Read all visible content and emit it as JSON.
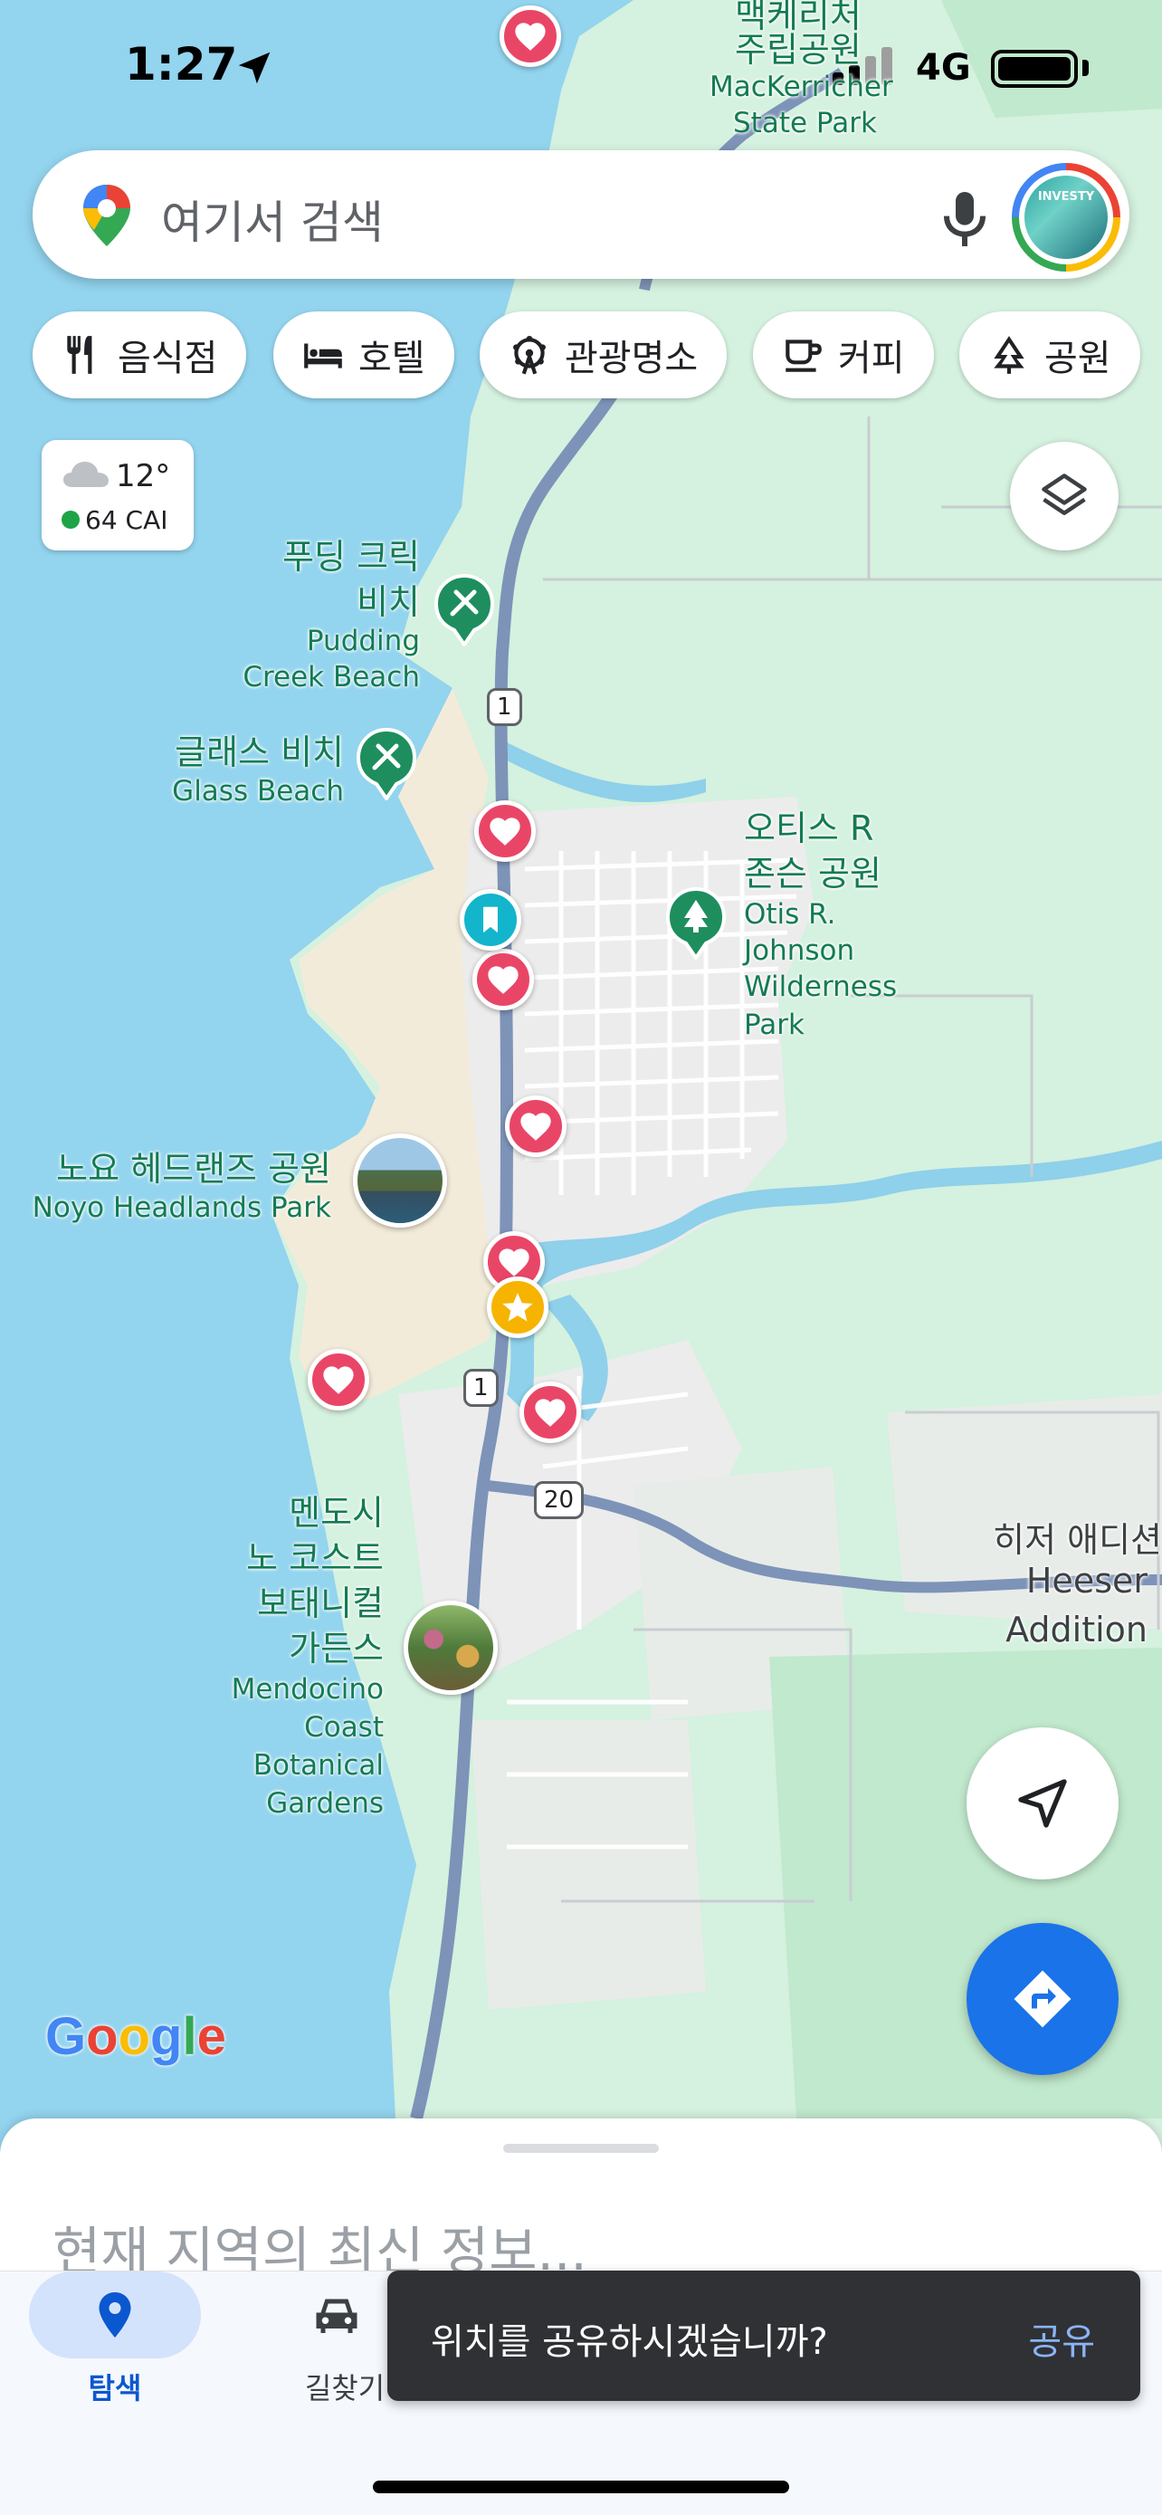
{
  "status_bar": {
    "time": "1:27",
    "network": "4G"
  },
  "search": {
    "placeholder": "여기서 검색",
    "avatar_text": "INVESTY"
  },
  "chips": [
    {
      "label": "음식점",
      "icon": "restaurant-icon"
    },
    {
      "label": "호텔",
      "icon": "hotel-icon"
    },
    {
      "label": "관광명소",
      "icon": "attractions-icon"
    },
    {
      "label": "커피",
      "icon": "coffee-icon"
    },
    {
      "label": "공원",
      "icon": "park-icon"
    }
  ],
  "weather": {
    "temperature": "12°",
    "air_quality": "64 CAI",
    "aqi_color": "#1ea446"
  },
  "map_labels": {
    "top_park_ko_line1": "맥케리처",
    "top_park_ko_line2": "주립공원",
    "top_park_en_line1": "MacKerricher",
    "top_park_en_line2": "State Park",
    "pudding_ko_line1": "푸딩 크릭",
    "pudding_ko_line2": "비치",
    "pudding_en_line1": "Pudding",
    "pudding_en_line2": "Creek Beach",
    "glass_ko": "글래스 비치",
    "glass_en": "Glass Beach",
    "otis_ko_line1": "오티스 R",
    "otis_ko_line2": "존슨 공원",
    "otis_en_line1": "Otis R.",
    "otis_en_line2": "Johnson",
    "otis_en_line3": "Wilderness",
    "otis_en_line4": "Park",
    "noyo_ko": "노요 헤드랜즈 공원",
    "noyo_en": "Noyo Headlands Park",
    "mendo_ko_line1": "멘도시",
    "mendo_ko_line2": "노 코스트",
    "mendo_ko_line3": "보태니컬",
    "mendo_ko_line4": "가든스",
    "mendo_en_line1": "Mendocino",
    "mendo_en_line2": "Coast",
    "mendo_en_line3": "Botanical",
    "mendo_en_line4": "Gardens",
    "heeser_ko": "히저 애디션",
    "heeser_en_line1": "Heeser",
    "heeser_en_line2": "Addition"
  },
  "route_shields": {
    "route_1": "1",
    "route_20": "20"
  },
  "google_logo": [
    "G",
    "o",
    "o",
    "g",
    "l",
    "e"
  ],
  "bottom_sheet": {
    "heading": "현재 지역의 최신 정보..."
  },
  "bottom_nav": [
    {
      "label": "탐색",
      "icon": "explore-pin-icon",
      "active": true
    },
    {
      "label": "길찾기",
      "icon": "car-icon",
      "active": false
    }
  ],
  "snackbar": {
    "message": "위치를 공유하시겠습니까?",
    "action": "공유"
  },
  "colors": {
    "accent": "#1a73e8",
    "heart_marker": "#e94667",
    "park_marker": "#1e8e5e",
    "water": "#a6dcf0",
    "land": "#d9f2e3"
  }
}
